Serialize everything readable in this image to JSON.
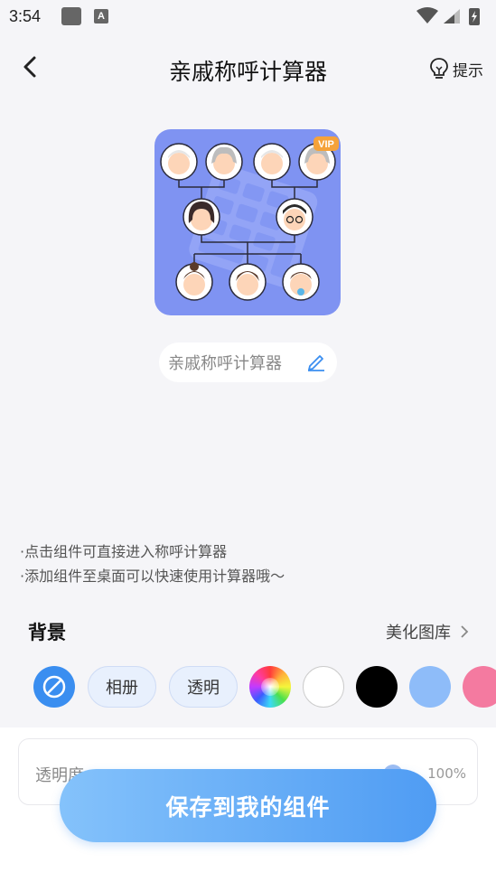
{
  "status": {
    "time": "3:54"
  },
  "header": {
    "title": "亲戚称呼计算器",
    "hint_label": "提示"
  },
  "widget": {
    "name": "亲戚称呼计算器",
    "badge": "VIP"
  },
  "tips": [
    "·点击组件可直接进入称呼计算器",
    "·添加组件至桌面可以快速使用计算器哦～"
  ],
  "background": {
    "title": "背景",
    "gallery_label": "美化图库",
    "options": {
      "album": "相册",
      "transparent": "透明"
    },
    "colors": [
      "#ffffff",
      "#000000",
      "#8ebcf9",
      "#f47aa0"
    ],
    "selected_color": "#3a8ef0"
  },
  "opacity": {
    "label": "透明度",
    "value": "100%"
  },
  "save_button": "保存到我的组件"
}
